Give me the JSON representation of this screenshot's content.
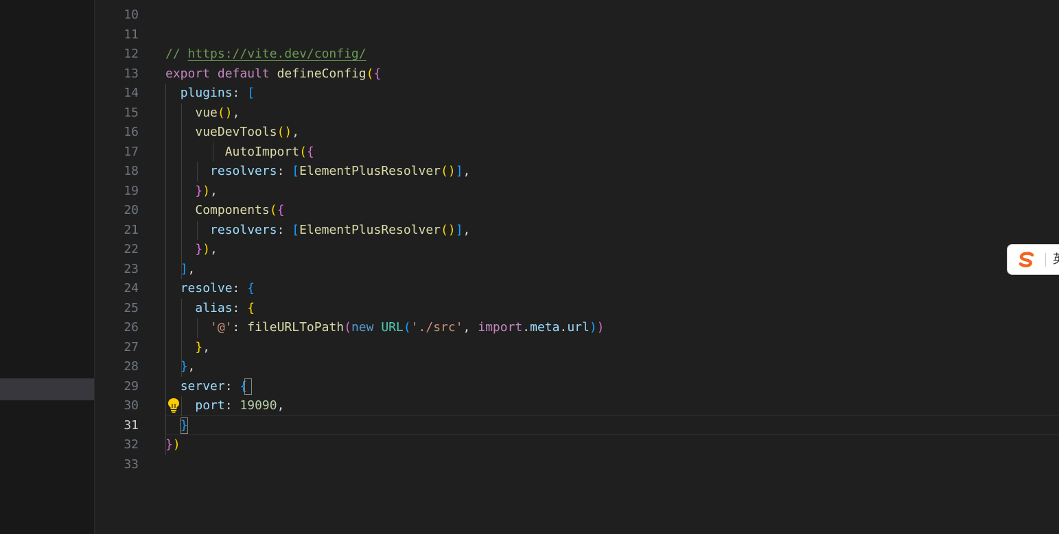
{
  "editor": {
    "active_line": "31",
    "lines": [
      {
        "num": "10",
        "tokens": []
      },
      {
        "num": "11",
        "tokens": []
      },
      {
        "num": "12",
        "tokens": [
          {
            "t": "// ",
            "c": "cmt"
          },
          {
            "t": "https://vite.dev/config/",
            "c": "link"
          }
        ]
      },
      {
        "num": "13",
        "tokens": [
          {
            "t": "export",
            "c": "kw"
          },
          {
            "t": " ",
            "c": "punc"
          },
          {
            "t": "default",
            "c": "kw"
          },
          {
            "t": " ",
            "c": "punc"
          },
          {
            "t": "defineConfig",
            "c": "fn"
          },
          {
            "t": "(",
            "c": "b1"
          },
          {
            "t": "{",
            "c": "b2"
          }
        ]
      },
      {
        "num": "14",
        "tokens": [
          {
            "t": "  ",
            "c": "punc"
          },
          {
            "t": "plugins",
            "c": "prop"
          },
          {
            "t": ": ",
            "c": "punc"
          },
          {
            "t": "[",
            "c": "b3"
          }
        ]
      },
      {
        "num": "15",
        "tokens": [
          {
            "t": "    ",
            "c": "punc"
          },
          {
            "t": "vue",
            "c": "fn"
          },
          {
            "t": "()",
            "c": "b1"
          },
          {
            "t": ",",
            "c": "punc"
          }
        ]
      },
      {
        "num": "16",
        "tokens": [
          {
            "t": "    ",
            "c": "punc"
          },
          {
            "t": "vueDevTools",
            "c": "fn"
          },
          {
            "t": "()",
            "c": "b1"
          },
          {
            "t": ",",
            "c": "punc"
          }
        ]
      },
      {
        "num": "17",
        "tokens": [
          {
            "t": "        ",
            "c": "punc"
          },
          {
            "t": "AutoImport",
            "c": "fn"
          },
          {
            "t": "(",
            "c": "b1"
          },
          {
            "t": "{",
            "c": "b2"
          }
        ]
      },
      {
        "num": "18",
        "tokens": [
          {
            "t": "      ",
            "c": "punc"
          },
          {
            "t": "resolvers",
            "c": "prop"
          },
          {
            "t": ": ",
            "c": "punc"
          },
          {
            "t": "[",
            "c": "b3"
          },
          {
            "t": "ElementPlusResolver",
            "c": "fn"
          },
          {
            "t": "()",
            "c": "b1"
          },
          {
            "t": "]",
            "c": "b3"
          },
          {
            "t": ",",
            "c": "punc"
          }
        ]
      },
      {
        "num": "19",
        "tokens": [
          {
            "t": "    ",
            "c": "punc"
          },
          {
            "t": "}",
            "c": "b2"
          },
          {
            "t": ")",
            "c": "b1"
          },
          {
            "t": ",",
            "c": "punc"
          }
        ]
      },
      {
        "num": "20",
        "tokens": [
          {
            "t": "    ",
            "c": "punc"
          },
          {
            "t": "Components",
            "c": "fn"
          },
          {
            "t": "(",
            "c": "b1"
          },
          {
            "t": "{",
            "c": "b2"
          }
        ]
      },
      {
        "num": "21",
        "tokens": [
          {
            "t": "      ",
            "c": "punc"
          },
          {
            "t": "resolvers",
            "c": "prop"
          },
          {
            "t": ": ",
            "c": "punc"
          },
          {
            "t": "[",
            "c": "b3"
          },
          {
            "t": "ElementPlusResolver",
            "c": "fn"
          },
          {
            "t": "()",
            "c": "b1"
          },
          {
            "t": "]",
            "c": "b3"
          },
          {
            "t": ",",
            "c": "punc"
          }
        ]
      },
      {
        "num": "22",
        "tokens": [
          {
            "t": "    ",
            "c": "punc"
          },
          {
            "t": "}",
            "c": "b2"
          },
          {
            "t": ")",
            "c": "b1"
          },
          {
            "t": ",",
            "c": "punc"
          }
        ]
      },
      {
        "num": "23",
        "tokens": [
          {
            "t": "  ",
            "c": "punc"
          },
          {
            "t": "]",
            "c": "b3"
          },
          {
            "t": ",",
            "c": "punc"
          }
        ]
      },
      {
        "num": "24",
        "tokens": [
          {
            "t": "  ",
            "c": "punc"
          },
          {
            "t": "resolve",
            "c": "prop"
          },
          {
            "t": ": ",
            "c": "punc"
          },
          {
            "t": "{",
            "c": "b3"
          }
        ]
      },
      {
        "num": "25",
        "tokens": [
          {
            "t": "    ",
            "c": "punc"
          },
          {
            "t": "alias",
            "c": "prop"
          },
          {
            "t": ": ",
            "c": "punc"
          },
          {
            "t": "{",
            "c": "b1"
          }
        ]
      },
      {
        "num": "26",
        "tokens": [
          {
            "t": "      ",
            "c": "punc"
          },
          {
            "t": "'@'",
            "c": "str"
          },
          {
            "t": ": ",
            "c": "punc"
          },
          {
            "t": "fileURLToPath",
            "c": "fn"
          },
          {
            "t": "(",
            "c": "b2"
          },
          {
            "t": "new",
            "c": "kw2"
          },
          {
            "t": " ",
            "c": "punc"
          },
          {
            "t": "URL",
            "c": "cls"
          },
          {
            "t": "(",
            "c": "b3"
          },
          {
            "t": "'./src'",
            "c": "str"
          },
          {
            "t": ", ",
            "c": "punc"
          },
          {
            "t": "import",
            "c": "kw"
          },
          {
            "t": ".",
            "c": "punc"
          },
          {
            "t": "meta",
            "c": "prop"
          },
          {
            "t": ".",
            "c": "punc"
          },
          {
            "t": "url",
            "c": "prop"
          },
          {
            "t": ")",
            "c": "b3"
          },
          {
            "t": ")",
            "c": "b2"
          }
        ]
      },
      {
        "num": "27",
        "tokens": [
          {
            "t": "    ",
            "c": "punc"
          },
          {
            "t": "}",
            "c": "b1"
          },
          {
            "t": ",",
            "c": "punc"
          }
        ]
      },
      {
        "num": "28",
        "tokens": [
          {
            "t": "  ",
            "c": "punc"
          },
          {
            "t": "}",
            "c": "b3"
          },
          {
            "t": ",",
            "c": "punc"
          }
        ]
      },
      {
        "num": "29",
        "tokens": [
          {
            "t": "  ",
            "c": "punc"
          },
          {
            "t": "server",
            "c": "prop"
          },
          {
            "t": ": ",
            "c": "punc"
          },
          {
            "t": "{",
            "c": "b3"
          }
        ]
      },
      {
        "num": "30",
        "tokens": [
          {
            "t": "    ",
            "c": "punc"
          },
          {
            "t": "port",
            "c": "prop"
          },
          {
            "t": ": ",
            "c": "punc"
          },
          {
            "t": "19090",
            "c": "num"
          },
          {
            "t": ",",
            "c": "punc"
          }
        ]
      },
      {
        "num": "31",
        "tokens": [
          {
            "t": "  ",
            "c": "punc"
          },
          {
            "t": "}",
            "c": "b3"
          }
        ]
      },
      {
        "num": "32",
        "tokens": [
          {
            "t": "}",
            "c": "b2"
          },
          {
            "t": ")",
            "c": "b1"
          }
        ]
      },
      {
        "num": "33",
        "tokens": []
      }
    ]
  },
  "ime": {
    "icon": "sogou-s-logo-icon",
    "mode_label": "英",
    "logo_color": "#f26522"
  },
  "icons": {
    "lightbulb": "lightbulb-icon"
  },
  "colors": {
    "editor_bg": "#1f1f1f",
    "sidebar_bg": "#181818",
    "selection": "#37373d",
    "lightbulb": "#ffcc00"
  }
}
